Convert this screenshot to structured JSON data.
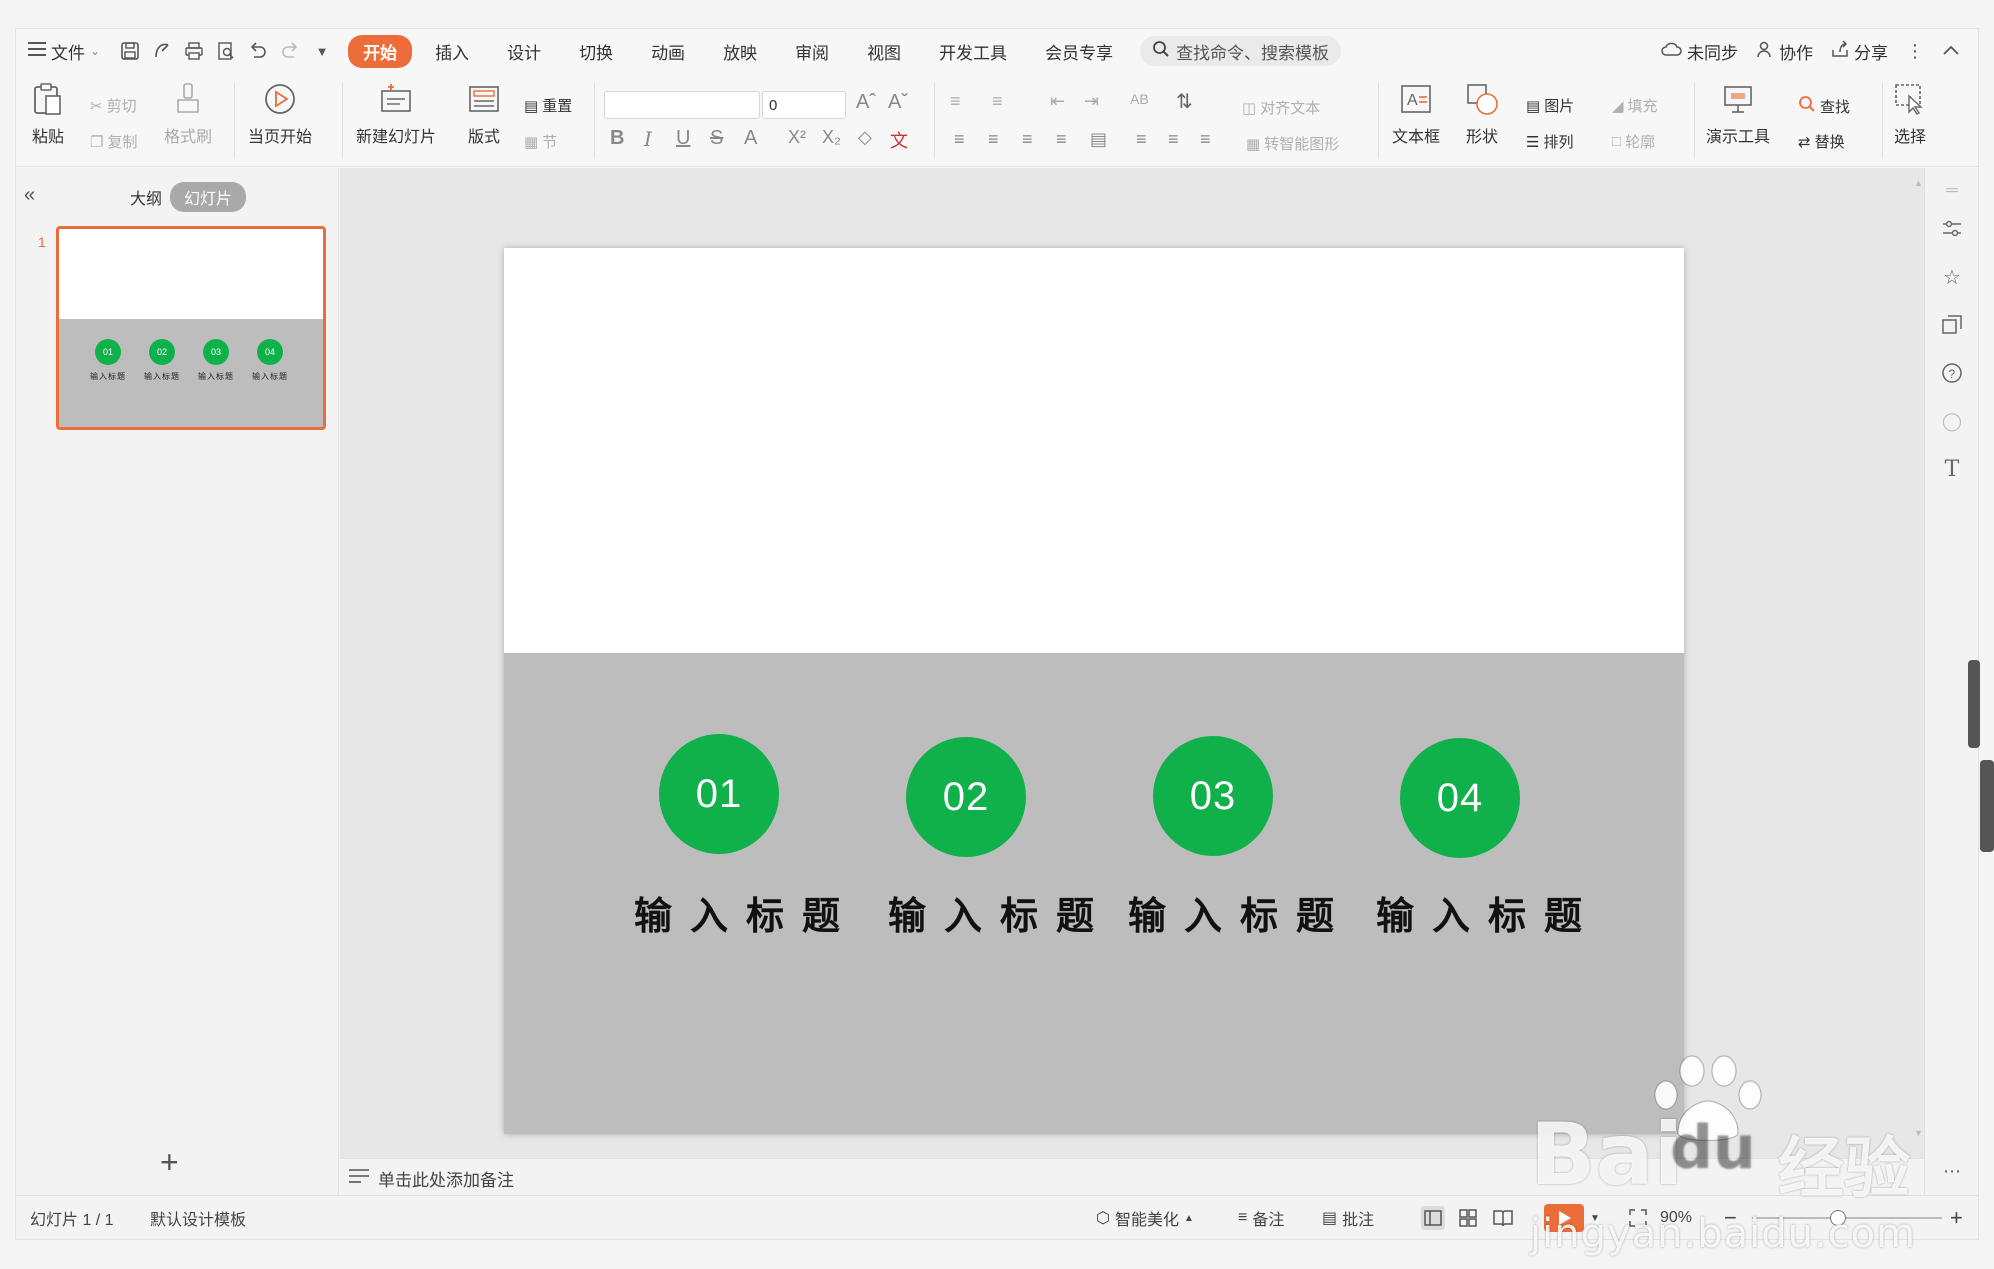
{
  "menubar": {
    "file_label": "文件",
    "tabs": [
      {
        "label": "开始",
        "active": true
      },
      {
        "label": "插入"
      },
      {
        "label": "设计"
      },
      {
        "label": "切换"
      },
      {
        "label": "动画"
      },
      {
        "label": "放映"
      },
      {
        "label": "审阅"
      },
      {
        "label": "视图"
      },
      {
        "label": "开发工具"
      },
      {
        "label": "会员专享"
      }
    ],
    "search_placeholder": "查找命令、搜索模板",
    "sync_label": "未同步",
    "collab_label": "协作",
    "share_label": "分享"
  },
  "ribbon": {
    "paste": "粘贴",
    "cut": "剪切",
    "copy": "复制",
    "format_painter": "格式刷",
    "start_from_current": "当页开始",
    "new_slide": "新建幻灯片",
    "layout": "版式",
    "reset": "重置",
    "section": "节",
    "font_size": "0",
    "align_text": "对齐文本",
    "convert_smartart": "转智能图形",
    "textbox": "文本框",
    "shape": "形状",
    "picture": "图片",
    "arrange": "排列",
    "fill": "填充",
    "outline": "轮廓",
    "presentation_tools": "演示工具",
    "find": "查找",
    "replace": "替换",
    "select": "选择"
  },
  "leftpanel": {
    "outline_tab": "大纲",
    "slides_tab": "幻灯片",
    "slide_number": "1",
    "add_button": "+"
  },
  "slide": {
    "items": [
      {
        "number": "01",
        "title": "输入标题"
      },
      {
        "number": "02",
        "title": "输入标题"
      },
      {
        "number": "03",
        "title": "输入标题"
      },
      {
        "number": "04",
        "title": "输入标题"
      }
    ],
    "accent_color": "#10b14a",
    "band_color": "#bdbdbd"
  },
  "notes": {
    "placeholder": "单击此处添加备注"
  },
  "statusbar": {
    "slide_count": "幻灯片 1 / 1",
    "template": "默认设计模板",
    "beautify": "智能美化",
    "notes": "备注",
    "comments": "批注",
    "zoom": "90%"
  },
  "watermark": {
    "brand": "Bai",
    "brand2": "du",
    "product": "经验",
    "url": "jingyan.baidu.com"
  }
}
